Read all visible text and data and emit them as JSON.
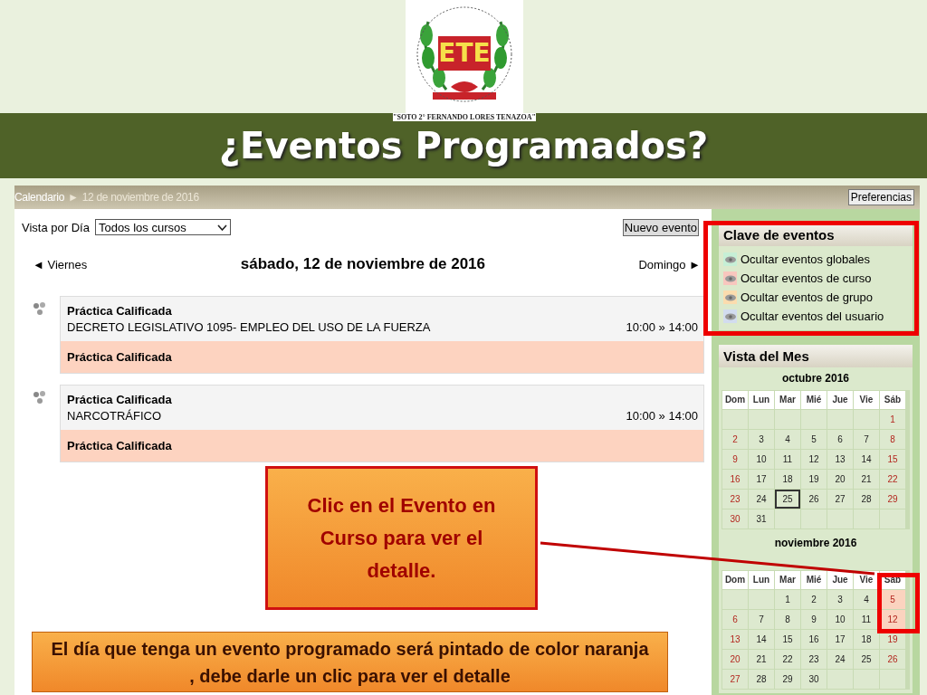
{
  "slide": {
    "title": "¿Eventos Programados?"
  },
  "logo": {
    "initials": "ETE",
    "motto": "\"SOTO 2° FERNANDO LORES TENAZOA\""
  },
  "breadcrumb": {
    "items": [
      "Calendario",
      "12 de noviembre de 2016"
    ],
    "separator": "►"
  },
  "preferences_button": "Preferencias",
  "view": {
    "label": "Vista por Día",
    "course_select": "Todos los cursos",
    "new_event_button": "Nuevo evento"
  },
  "day_nav": {
    "previous": "◄ Viernes",
    "title": "sábado, 12 de noviembre de 2016",
    "next": "Domingo ►"
  },
  "events": [
    {
      "title": "Práctica Calificada",
      "description": "DECRETO LEGISLATIVO 1095- EMPLEO DEL USO DE LA FUERZA",
      "time": "10:00 » 14:00",
      "footer": "Práctica Calificada"
    },
    {
      "title": "Práctica Calificada",
      "description": "NARCOTRÁFICO",
      "time": "10:00 » 14:00",
      "footer": "Práctica Calificada"
    }
  ],
  "event_key": {
    "title": "Clave de eventos",
    "items": [
      {
        "label": "Ocultar eventos globales",
        "color": "#c6efd6"
      },
      {
        "label": "Ocultar eventos de curso",
        "color": "#f8c6be"
      },
      {
        "label": "Ocultar eventos de grupo",
        "color": "#fbdcae"
      },
      {
        "label": "Ocultar eventos del usuario",
        "color": "#d2dcef"
      }
    ]
  },
  "month_view": {
    "title": "Vista del Mes",
    "months": [
      {
        "name": "octubre 2016",
        "weekdays": [
          "Dom",
          "Lun",
          "Mar",
          "Mié",
          "Jue",
          "Vie",
          "Sáb"
        ],
        "weeks": [
          [
            {
              "kind": "blank"
            },
            {
              "kind": "blank"
            },
            {
              "kind": "blank"
            },
            {
              "kind": "blank"
            },
            {
              "kind": "blank"
            },
            {
              "kind": "blank"
            },
            {
              "kind": "day",
              "day": "1",
              "event": false,
              "today": false
            }
          ],
          [
            {
              "day": "2",
              "event": false,
              "today": false
            },
            {
              "day": "3",
              "event": false,
              "today": false
            },
            {
              "day": "4",
              "event": false,
              "today": false
            },
            {
              "day": "5",
              "event": false,
              "today": false
            },
            {
              "day": "6",
              "event": false,
              "today": false
            },
            {
              "day": "7",
              "event": false,
              "today": false
            },
            {
              "day": "8",
              "event": false,
              "today": false
            }
          ],
          [
            {
              "day": "9",
              "event": false,
              "today": false
            },
            {
              "day": "10",
              "event": false,
              "today": false
            },
            {
              "day": "11",
              "event": false,
              "today": false
            },
            {
              "day": "12",
              "event": false,
              "today": false
            },
            {
              "day": "13",
              "event": false,
              "today": false
            },
            {
              "day": "14",
              "event": false,
              "today": false
            },
            {
              "day": "15",
              "event": false,
              "today": false
            }
          ],
          [
            {
              "day": "16",
              "event": false,
              "today": false
            },
            {
              "day": "17",
              "event": false,
              "today": false
            },
            {
              "day": "18",
              "event": false,
              "today": false
            },
            {
              "day": "19",
              "event": false,
              "today": false
            },
            {
              "day": "20",
              "event": false,
              "today": false
            },
            {
              "day": "21",
              "event": false,
              "today": false
            },
            {
              "day": "22",
              "event": false,
              "today": false
            }
          ],
          [
            {
              "day": "23",
              "event": false,
              "today": false
            },
            {
              "day": "24",
              "event": false,
              "today": false
            },
            {
              "day": "25",
              "event": false,
              "today": true
            },
            {
              "day": "26",
              "event": false,
              "today": false
            },
            {
              "day": "27",
              "event": false,
              "today": false
            },
            {
              "day": "28",
              "event": false,
              "today": false
            },
            {
              "day": "29",
              "event": false,
              "today": false
            }
          ],
          [
            {
              "day": "30",
              "event": false,
              "today": false
            },
            {
              "day": "31",
              "event": false,
              "today": false
            },
            {
              "kind": "blank"
            },
            {
              "kind": "blank"
            },
            {
              "kind": "blank"
            },
            {
              "kind": "blank"
            },
            {
              "kind": "blank"
            }
          ]
        ]
      },
      {
        "name": "noviembre 2016",
        "weekdays": [
          "Dom",
          "Lun",
          "Mar",
          "Mié",
          "Jue",
          "Vie",
          "Sáb"
        ],
        "weeks": [
          [
            {
              "kind": "blank"
            },
            {
              "kind": "blank"
            },
            {
              "day": "1",
              "event": false,
              "today": false
            },
            {
              "day": "2",
              "event": false,
              "today": false
            },
            {
              "day": "3",
              "event": false,
              "today": false
            },
            {
              "day": "4",
              "event": false,
              "today": false
            },
            {
              "day": "5",
              "event": true,
              "today": false
            }
          ],
          [
            {
              "day": "6",
              "event": false,
              "today": false
            },
            {
              "day": "7",
              "event": false,
              "today": false
            },
            {
              "day": "8",
              "event": false,
              "today": false
            },
            {
              "day": "9",
              "event": false,
              "today": false
            },
            {
              "day": "10",
              "event": false,
              "today": false
            },
            {
              "day": "11",
              "event": false,
              "today": false
            },
            {
              "day": "12",
              "event": true,
              "today": false
            }
          ],
          [
            {
              "day": "13",
              "event": false,
              "today": false
            },
            {
              "day": "14",
              "event": false,
              "today": false
            },
            {
              "day": "15",
              "event": false,
              "today": false
            },
            {
              "day": "16",
              "event": false,
              "today": false
            },
            {
              "day": "17",
              "event": false,
              "today": false
            },
            {
              "day": "18",
              "event": false,
              "today": false
            },
            {
              "day": "19",
              "event": false,
              "today": false
            }
          ],
          [
            {
              "day": "20",
              "event": false,
              "today": false
            },
            {
              "day": "21",
              "event": false,
              "today": false
            },
            {
              "day": "22",
              "event": false,
              "today": false
            },
            {
              "day": "23",
              "event": false,
              "today": false
            },
            {
              "day": "24",
              "event": false,
              "today": false
            },
            {
              "day": "25",
              "event": false,
              "today": false
            },
            {
              "day": "26",
              "event": false,
              "today": false
            }
          ],
          [
            {
              "day": "27",
              "event": false,
              "today": false
            },
            {
              "day": "28",
              "event": false,
              "today": false
            },
            {
              "day": "29",
              "event": false,
              "today": false
            },
            {
              "day": "30",
              "event": false,
              "today": false
            },
            {
              "kind": "blank"
            },
            {
              "kind": "blank"
            },
            {
              "kind": "blank"
            }
          ]
        ]
      }
    ]
  },
  "callouts": [
    {
      "kind": "boxed",
      "text": "Clic  en el Evento en Curso para ver el detalle."
    },
    {
      "kind": "banner",
      "text": "El día  que tenga un evento programado será pintado de color naranja , debe darle un clic para ver el detalle"
    }
  ]
}
